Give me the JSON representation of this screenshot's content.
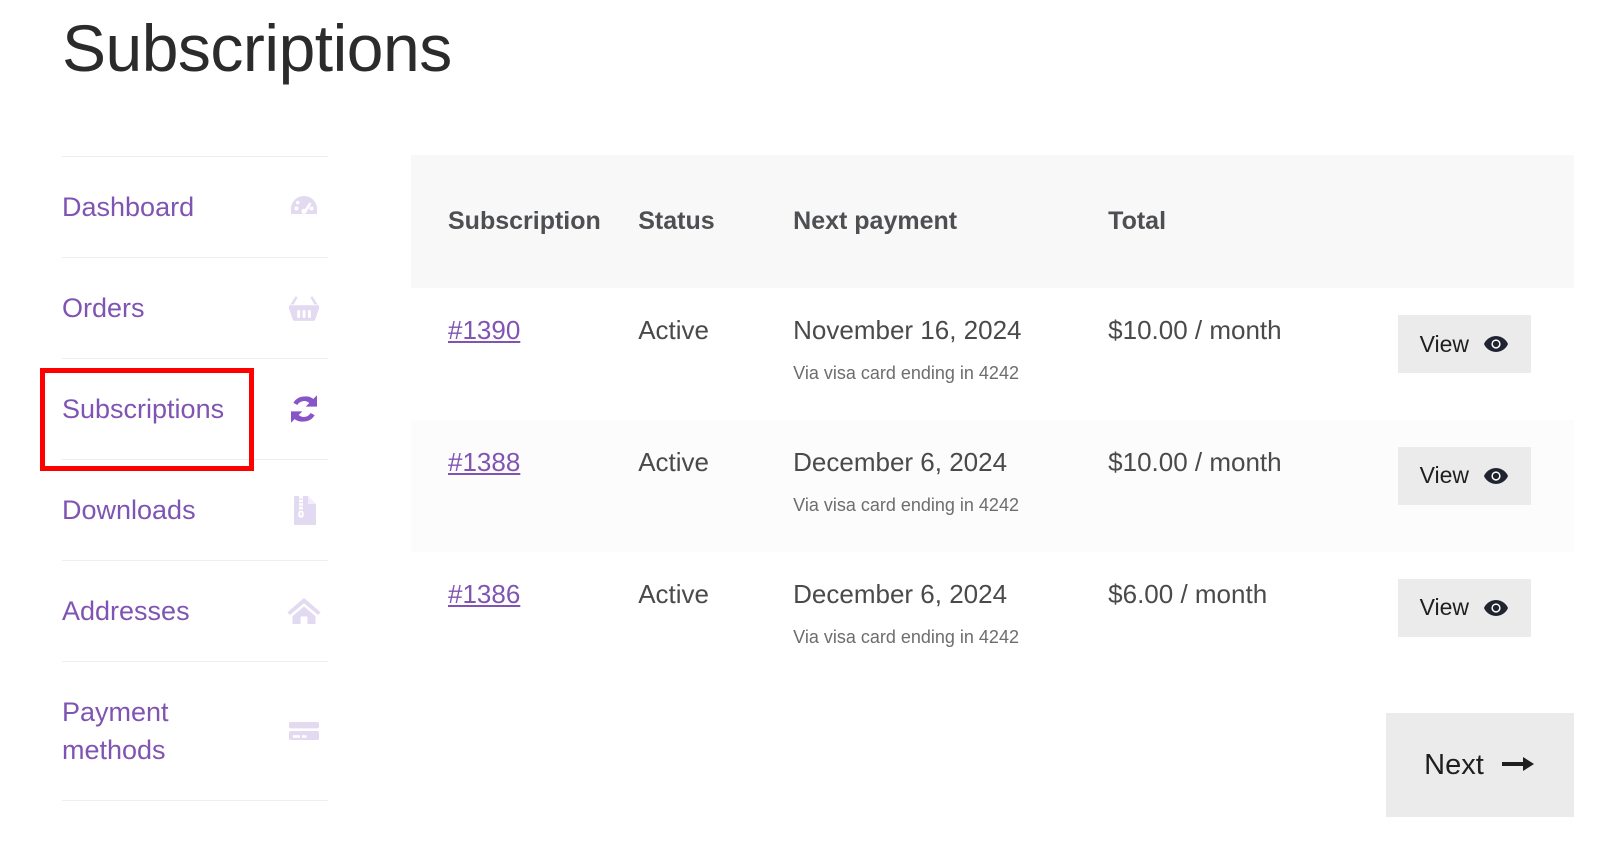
{
  "page": {
    "title": "Subscriptions"
  },
  "sidebar": {
    "items": [
      {
        "label": "Dashboard",
        "icon": "gauge-icon",
        "active": false
      },
      {
        "label": "Orders",
        "icon": "basket-icon",
        "active": false
      },
      {
        "label": "Subscriptions",
        "icon": "refresh-icon",
        "active": true
      },
      {
        "label": "Downloads",
        "icon": "zip-file-icon",
        "active": false
      },
      {
        "label": "Addresses",
        "icon": "home-icon",
        "active": false
      },
      {
        "label": "Payment methods",
        "icon": "credit-card-icon",
        "active": false
      }
    ]
  },
  "table": {
    "headers": [
      "Subscription",
      "Status",
      "Next payment",
      "Total",
      ""
    ],
    "rows": [
      {
        "subscription": "#1390",
        "status": "Active",
        "next_payment": "November 16, 2024",
        "next_payment_note": "Via visa card ending in 4242",
        "total": "$10.00 / month",
        "action": "View"
      },
      {
        "subscription": "#1388",
        "status": "Active",
        "next_payment": "December 6, 2024",
        "next_payment_note": "Via visa card ending in 4242",
        "total": "$10.00 / month",
        "action": "View"
      },
      {
        "subscription": "#1386",
        "status": "Active",
        "next_payment": "December 6, 2024",
        "next_payment_note": "Via visa card ending in 4242",
        "total": "$6.00 / month",
        "action": "View"
      }
    ]
  },
  "pagination": {
    "next_label": "Next"
  },
  "colors": {
    "accent_purple": "#7f54b3",
    "icon_active": "#8855c8",
    "icon_muted": "#e2daf0",
    "highlight_red": "#fe0000",
    "header_bg": "#f8f8f8",
    "button_bg": "#ebebeb"
  }
}
